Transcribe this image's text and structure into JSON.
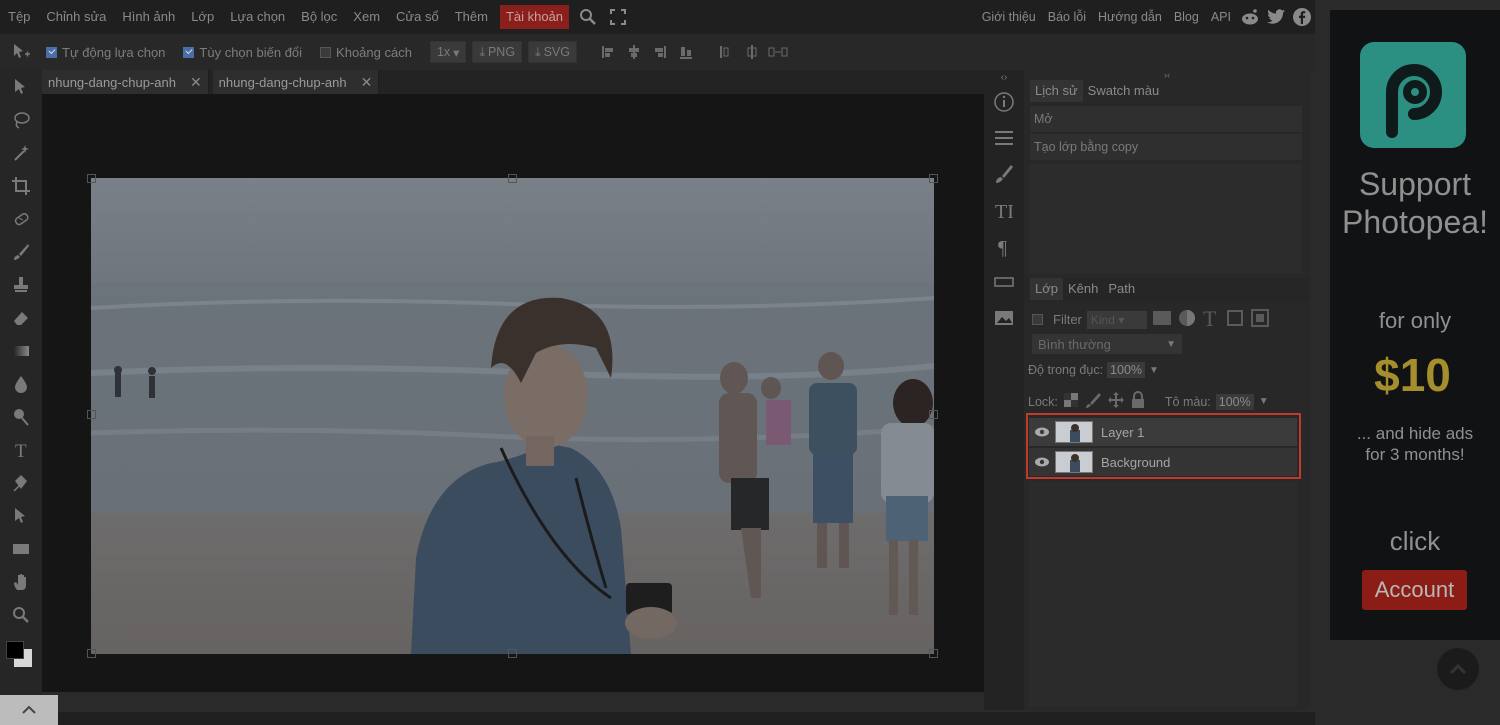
{
  "menu": {
    "items": [
      "Tệp",
      "Chỉnh sửa",
      "Hình ảnh",
      "Lớp",
      "Lựa chọn",
      "Bộ lọc",
      "Xem",
      "Cửa sổ",
      "Thêm"
    ],
    "account": "Tài khoản",
    "right_items": [
      "Giới thiệu",
      "Báo lỗi",
      "Hướng dẫn",
      "Blog",
      "API"
    ]
  },
  "options": {
    "auto_select": "Tự động lựa chọn",
    "transform": "Tùy chọn biến đổi",
    "distance": "Khoảng cách",
    "zoom": "1x",
    "png": "PNG",
    "svg": "SVG"
  },
  "tabs": [
    {
      "label": "nhung-dang-chup-anh"
    },
    {
      "label": "nhung-dang-chup-anh"
    }
  ],
  "history": {
    "tabs": [
      "Lịch sử",
      "Swatch màu"
    ],
    "items": [
      "Mở",
      "Tạo lớp bằng copy"
    ]
  },
  "layers": {
    "tabs": [
      "Lớp",
      "Kênh",
      "Path"
    ],
    "filter_label": "Filter",
    "kind_placeholder": "Kind",
    "blend_mode": "Bình thường",
    "opacity_label": "Độ trong đục:",
    "opacity_value": "100%",
    "lock_label": "Lock:",
    "fill_label": "Tô màu:",
    "fill_value": "100%",
    "items": [
      {
        "name": "Layer 1"
      },
      {
        "name": "Background"
      }
    ]
  },
  "ad": {
    "headline_1": "Support",
    "headline_2": "Photopea!",
    "for_only": "for only",
    "price": "$10",
    "hide_ads_1": "... and hide ads",
    "hide_ads_2": "for 3 months!",
    "click": "click",
    "button": "Account"
  },
  "colors": {
    "accent_account": "#8b1f1b",
    "highlight_box": "#c0392b",
    "ad_logo": "#2b8f82",
    "ad_price": "#a48f2c"
  }
}
